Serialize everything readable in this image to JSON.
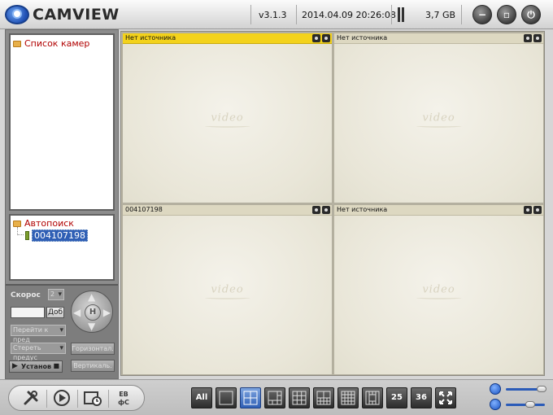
{
  "header": {
    "app_name": "CAMVIEW",
    "version": "v3.1.3",
    "datetime": "2014.04.09 20:26:08",
    "disk_space": "3,7 GB",
    "buttons": [
      {
        "name": "minimize",
        "glyph": "−"
      },
      {
        "name": "maximize",
        "glyph": "▫"
      },
      {
        "name": "power",
        "glyph": "⏻"
      }
    ]
  },
  "camera_list": {
    "title": "Список камер"
  },
  "autosearch": {
    "title": "Автопоиск",
    "items": [
      "004107198"
    ]
  },
  "ptz": {
    "speed_label": "Скорос",
    "speed_value": "2",
    "add_button": "Доб",
    "goto_preset": "Перейти к пред",
    "delete_preset": "Стереть предус",
    "setup_label": "Установ",
    "patrol_h": "Горизонтал.",
    "patrol_v": "Вертикаль."
  },
  "video_grid": {
    "watermark": "video",
    "cells": [
      {
        "label": "Нет источника",
        "active": true
      },
      {
        "label": "Нет источника",
        "active": false
      },
      {
        "label": "004107198",
        "active": false
      },
      {
        "label": "Нет источника",
        "active": false
      }
    ]
  },
  "bottom_toolbar": {
    "tools": [
      "settings-tool",
      "playback-tool",
      "schedule-tool",
      "language-tool"
    ],
    "language_glyph": "ЕВ\nфС",
    "layouts": [
      {
        "name": "layout-all",
        "label": "All"
      },
      {
        "name": "layout-1",
        "label": ""
      },
      {
        "name": "layout-4",
        "label": ""
      },
      {
        "name": "layout-6",
        "label": ""
      },
      {
        "name": "layout-9",
        "label": ""
      },
      {
        "name": "layout-10",
        "label": ""
      },
      {
        "name": "layout-13",
        "label": ""
      },
      {
        "name": "layout-16",
        "label": ""
      },
      {
        "name": "layout-fullgrid",
        "label": ""
      },
      {
        "name": "layout-25",
        "label": "25"
      },
      {
        "name": "layout-36",
        "label": "36"
      },
      {
        "name": "layout-fullscreen",
        "label": ""
      }
    ],
    "active_layout": "layout-4"
  },
  "colors": {
    "active_cell_header": "#f3d21b",
    "selected_item": "#2f5fb5",
    "tree_text": "#b10000"
  }
}
